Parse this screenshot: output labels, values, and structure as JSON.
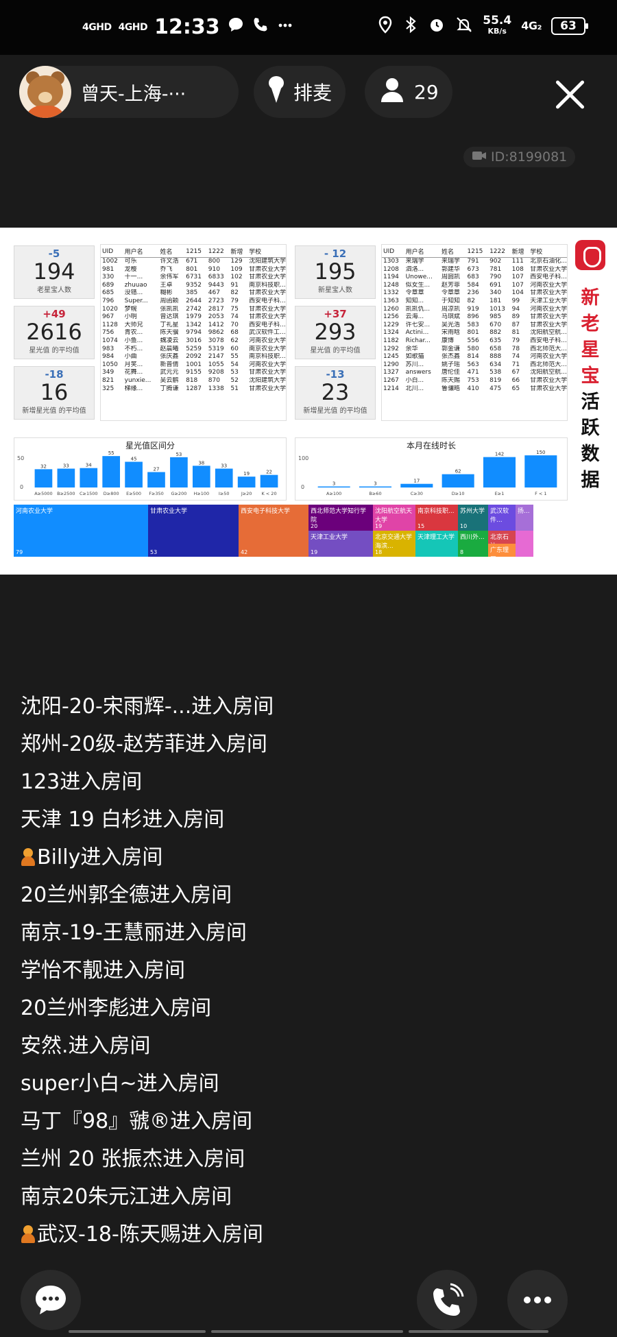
{
  "status_bar": {
    "sig1": "4GHD",
    "sig2": "4GHD",
    "time": "12:33",
    "speed": "55.4",
    "speed_unit": "KB/s",
    "net": "4G₂",
    "battery": "63"
  },
  "room": {
    "name": "曾天-上海-···",
    "mic_label": "排麦",
    "viewer_count": "29",
    "id_label": "ID:8199081"
  },
  "dashboard": {
    "left_kpis": [
      {
        "delta": "-5",
        "value": "194",
        "label": "老星宝人数"
      },
      {
        "delta": "+49",
        "value": "2616",
        "label": "星光值 的平均值"
      },
      {
        "delta": "-18",
        "value": "16",
        "label": "新增星光值 的平均值"
      }
    ],
    "right_kpis": [
      {
        "delta": "- 12",
        "value": "195",
        "label": "新星宝人数"
      },
      {
        "delta": "+37",
        "value": "293",
        "label": "星光值 的平均值"
      },
      {
        "delta": "-13",
        "value": "23",
        "label": "新增星光值 的平均值"
      }
    ],
    "table_headers": [
      "UID",
      "用户名",
      "姓名",
      "1215",
      "1222",
      "新增",
      "学校"
    ],
    "left_rows": [
      [
        "1002",
        "可乐",
        "许文浩",
        "671",
        "800",
        "129",
        "沈阳建筑大学"
      ],
      [
        "981",
        "龙樱",
        "乔飞",
        "801",
        "910",
        "109",
        "甘肃农业大学"
      ],
      [
        "330",
        "十一...",
        "余伟军",
        "6731",
        "6833",
        "102",
        "甘肃农业大学"
      ],
      [
        "689",
        "zhuuao",
        "王卓",
        "9352",
        "9443",
        "91",
        "南京科技职..."
      ],
      [
        "685",
        "没错...",
        "糊彬",
        "385",
        "467",
        "82",
        "甘肃农业大学"
      ],
      [
        "796",
        "Super...",
        "周函颖",
        "2644",
        "2723",
        "79",
        "西安电子科..."
      ],
      [
        "1020",
        "梦幌",
        "张凯凯",
        "2742",
        "2817",
        "75",
        "甘肃农业大学"
      ],
      [
        "967",
        "小明",
        "曾达琪",
        "1979",
        "2053",
        "74",
        "甘肃农业大学"
      ],
      [
        "1128",
        "大师兄",
        "丁礼星",
        "1342",
        "1412",
        "70",
        "西安电子科..."
      ],
      [
        "756",
        "青农...",
        "陈天骥",
        "9794",
        "9862",
        "68",
        "武汉软件工..."
      ],
      [
        "1074",
        "小鱼...",
        "魏凌云",
        "3016",
        "3078",
        "62",
        "河南农业大学"
      ],
      [
        "983",
        "不朽...",
        "赵晨曦",
        "5259",
        "5319",
        "60",
        "南京农业大学"
      ],
      [
        "984",
        "小曲",
        "张庆鑫",
        "2092",
        "2147",
        "55",
        "南京科技职..."
      ],
      [
        "1050",
        "月笑...",
        "新普倩",
        "1001",
        "1055",
        "54",
        "河南农业大学"
      ],
      [
        "349",
        "花舞...",
        "武元元",
        "9155",
        "9208",
        "53",
        "甘肃农业大学"
      ],
      [
        "821",
        "yunxie...",
        "吴云鹏",
        "818",
        "870",
        "52",
        "沈阳建筑大学"
      ],
      [
        "325",
        "梯缘...",
        "丁腾谦",
        "1287",
        "1338",
        "51",
        "甘肃农业大学"
      ]
    ],
    "right_rows": [
      [
        "1303",
        "来瑞学",
        "来瑞学",
        "791",
        "902",
        "111",
        "北京石油化..."
      ],
      [
        "1208",
        "泗洛...",
        "郭建华",
        "673",
        "781",
        "108",
        "甘肃农业大学"
      ],
      [
        "1194",
        "Unowe...",
        "周圆凯",
        "683",
        "790",
        "107",
        "西安电子科..."
      ],
      [
        "1248",
        "似女生...",
        "赵芳菲",
        "584",
        "691",
        "107",
        "河南农业大学"
      ],
      [
        "1332",
        "令章章",
        "令章章",
        "236",
        "340",
        "104",
        "甘肃农业大学"
      ],
      [
        "1363",
        "知知...",
        "于知知",
        "82",
        "181",
        "99",
        "天津工业大学"
      ],
      [
        "1260",
        "凯凯仇...",
        "周凉凯",
        "919",
        "1013",
        "94",
        "河南农业大学"
      ],
      [
        "1256",
        "云海...",
        "马琪斌",
        "896",
        "985",
        "89",
        "甘肃农业大学"
      ],
      [
        "1229",
        "许七安...",
        "吴光浩",
        "583",
        "670",
        "87",
        "甘肃农业大学"
      ],
      [
        "1324",
        "Actini...",
        "宋雨晗",
        "801",
        "882",
        "81",
        "沈阳航空航..."
      ],
      [
        "1182",
        "Richar...",
        "康博",
        "556",
        "635",
        "79",
        "西安电子科..."
      ],
      [
        "1292",
        "余华",
        "郭金谦",
        "580",
        "658",
        "78",
        "西北师范大..."
      ],
      [
        "1245",
        "如歌猫",
        "张杰鑫",
        "814",
        "888",
        "74",
        "河南农业大学"
      ],
      [
        "1290",
        "苏川...",
        "姚子瑶",
        "563",
        "634",
        "71",
        "西北师范大..."
      ],
      [
        "1327",
        "answers",
        "唐伦佳",
        "471",
        "538",
        "67",
        "沈阳航空航..."
      ],
      [
        "1267",
        "小白...",
        "陈天赐",
        "753",
        "819",
        "66",
        "甘肃农业大学"
      ],
      [
        "1214",
        "北川...",
        "鲁骧皓",
        "410",
        "475",
        "65",
        "甘肃农业大学"
      ]
    ],
    "hist_left": {
      "title": "星光值区间分",
      "ytick_top": "50",
      "ytick_bottom": "0"
    },
    "hist_right": {
      "title": "本月在线时长",
      "ytick_top": "100",
      "ytick_bottom": "0"
    },
    "treemap": [
      {
        "name": "河南农业大学",
        "value": "79",
        "color": "#118dff"
      },
      {
        "name": "甘肃农业大学",
        "value": "53",
        "color": "#1f26a8"
      },
      {
        "name": "西安电子科技大学",
        "value": "42",
        "color": "#e66c37"
      },
      {
        "name": "西北师范大学知行学院",
        "value": "20",
        "color": "#6b007b"
      },
      {
        "name": "沈阳航空航天大学",
        "value": "19",
        "color": "#e044a7"
      },
      {
        "name": "南京科技职...",
        "value": "15",
        "color": "#d9373f"
      },
      {
        "name": "苏州大学",
        "value": "10",
        "color": "#197278"
      },
      {
        "name": "武汉软件...",
        "value": "",
        "color": "#6c4ce0"
      },
      {
        "name": "扬...",
        "value": "",
        "color": "#a66fd8"
      },
      {
        "name": "天津工业大学",
        "value": "19",
        "color": "#744ec2"
      },
      {
        "name": "北京交通大学海滨...",
        "value": "18",
        "color": "#d9b300"
      },
      {
        "name": "天津理工大学",
        "value": "",
        "color": "#15c6b7"
      },
      {
        "name": "西川外...",
        "value": "8",
        "color": "#1aab40"
      },
      {
        "name": "北京石油...",
        "value": "",
        "color": "#d64550"
      },
      {
        "name": "广东理工...",
        "value": "",
        "color": "#fd8e3c"
      },
      {
        "name": "",
        "value": "",
        "color": "#e66ad3"
      }
    ],
    "brand_chars": [
      "新",
      "老",
      "星",
      "宝",
      "活",
      "跃",
      "数",
      "据"
    ],
    "colors": {
      "bar": "#118dff",
      "negative": "#3a6fb7",
      "positive": "#c6243a",
      "brand_red": "#d92030"
    }
  },
  "chart_data": [
    {
      "type": "bar",
      "title": "星光值区间分",
      "categories": [
        "A≥5000",
        "B≥2500",
        "C≥1500",
        "D≥800",
        "E≥500",
        "F≥350",
        "G≥200",
        "H≥100",
        "I≥50",
        "J≥20",
        "K < 20"
      ],
      "values": [
        32,
        33,
        34,
        55,
        45,
        27,
        53,
        38,
        33,
        19,
        22
      ],
      "ylim": [
        0,
        60
      ],
      "yticks": [
        "50",
        "0"
      ]
    },
    {
      "type": "bar",
      "title": "本月在线时长",
      "categories": [
        "A≥100",
        "B≥60",
        "C≥30",
        "D≥10",
        "E≥1",
        "F < 1"
      ],
      "values": [
        3,
        3,
        17,
        62,
        142,
        150
      ],
      "ylim": [
        0,
        160
      ],
      "yticks": [
        "100",
        "0"
      ]
    }
  ],
  "chat": [
    {
      "text": "沈阳-20-宋雨辉-...进入房间",
      "badge": false
    },
    {
      "text": "郑州-20级-赵芳菲进入房间",
      "badge": false
    },
    {
      "text": "123进入房间",
      "badge": false
    },
    {
      "text": "天津 19 白杉进入房间",
      "badge": false
    },
    {
      "text": "Billy进入房间",
      "badge": true
    },
    {
      "text": "20兰州郭全德进入房间",
      "badge": false
    },
    {
      "text": "南京-19-王慧丽进入房间",
      "badge": false
    },
    {
      "text": "学怡不靓进入房间",
      "badge": false
    },
    {
      "text": "20兰州李彪进入房间",
      "badge": false
    },
    {
      "text": "安然.进入房间",
      "badge": false
    },
    {
      "text": "super小白~进入房间",
      "badge": false
    },
    {
      "text": "马丁『98』虢®进入房间",
      "badge": false
    },
    {
      "text": "兰州 20 张振杰进入房间",
      "badge": false
    },
    {
      "text": "南京20朱元江进入房间",
      "badge": false
    },
    {
      "text": "武汉-18-陈天赐进入房间",
      "badge": true
    }
  ]
}
